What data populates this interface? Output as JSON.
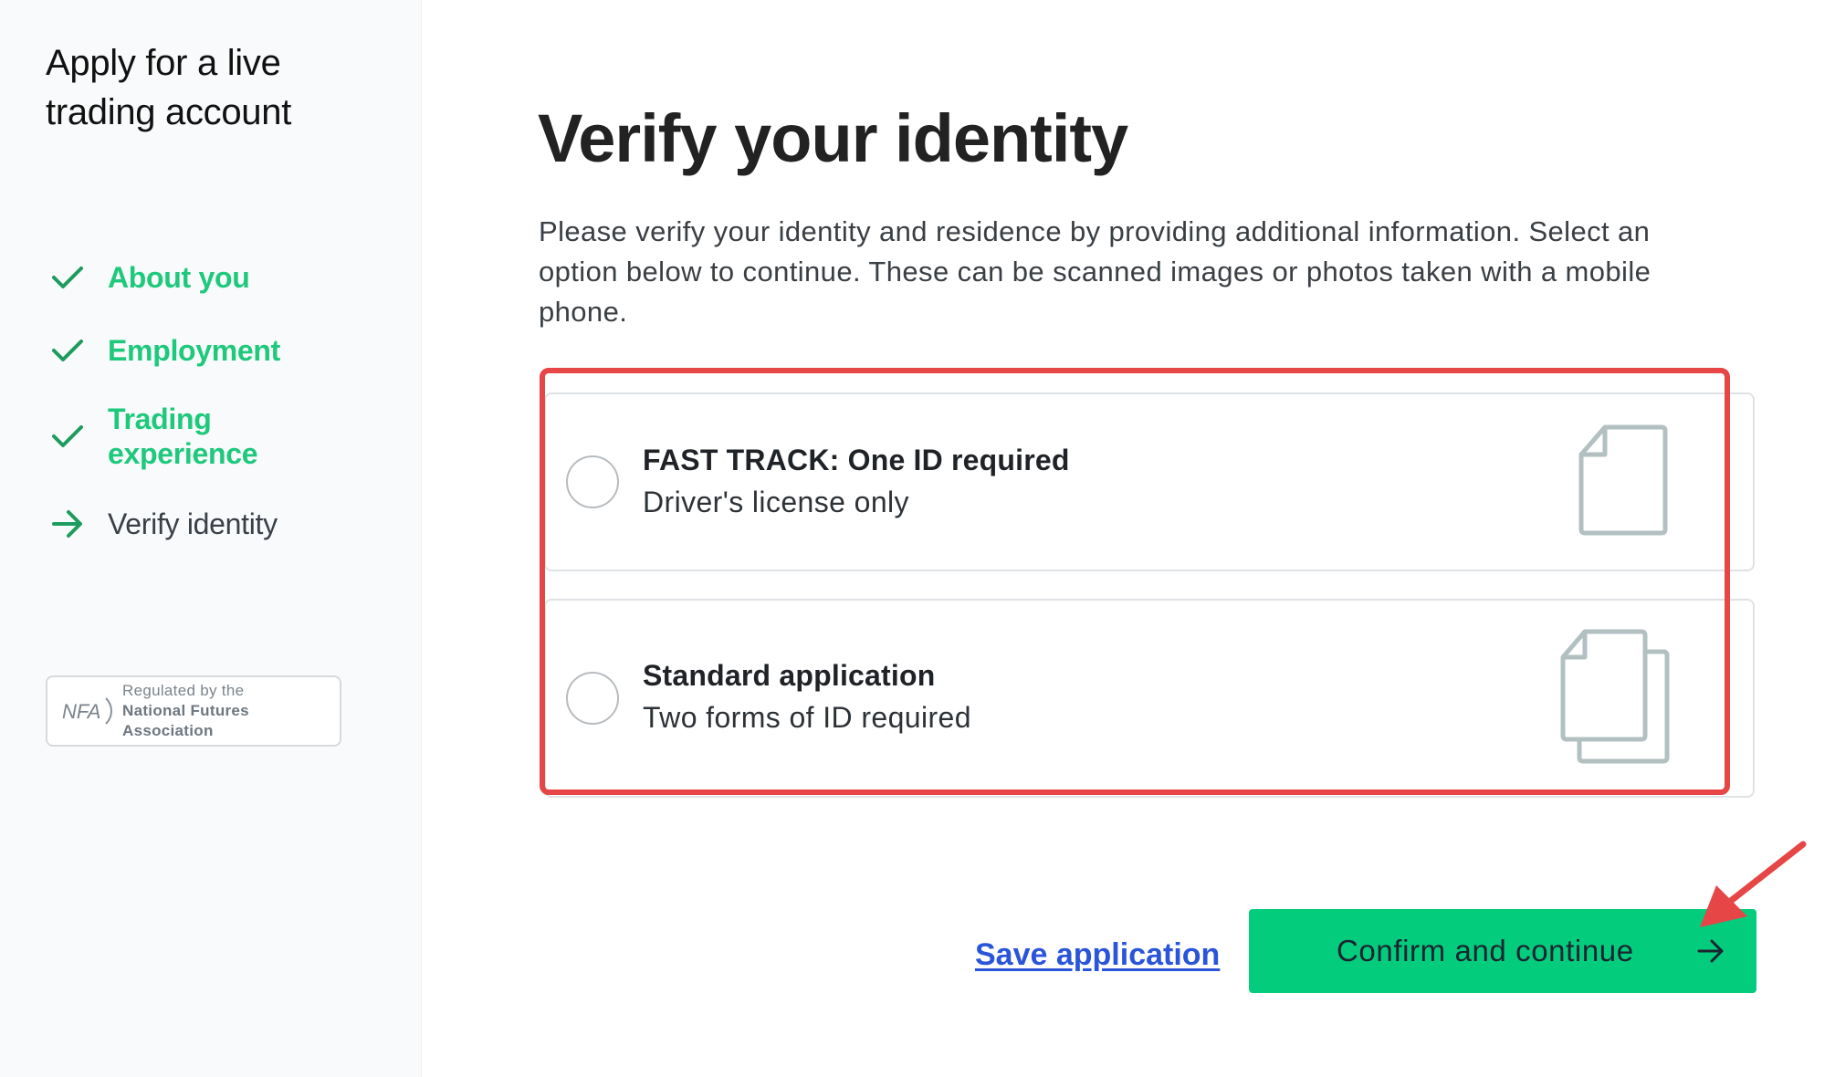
{
  "sidebar": {
    "title": "Apply for a live trading account",
    "steps": [
      {
        "label": "About you",
        "status": "complete",
        "icon": "check-icon"
      },
      {
        "label": "Employment",
        "status": "complete",
        "icon": "check-icon"
      },
      {
        "label": "Trading experience",
        "status": "complete",
        "icon": "check-icon"
      },
      {
        "label": "Verify identity",
        "status": "current",
        "icon": "arrow-right-icon"
      }
    ],
    "nfa_badge": {
      "logo_text": "NFA",
      "line1": "Regulated by the",
      "line2": "National Futures",
      "line3": "Association"
    }
  },
  "main": {
    "title": "Verify your identity",
    "description": "Please verify your identity and residence by providing additional information. Select an option below to continue. These can be scanned images or photos taken with a mobile phone.",
    "options": [
      {
        "title": "FAST TRACK: One ID required",
        "subtitle": "Driver's license only",
        "selected": false,
        "icon": "single-document-icon"
      },
      {
        "title": "Standard application",
        "subtitle": "Two forms of ID required",
        "selected": false,
        "icon": "two-documents-icon"
      }
    ],
    "save_label": "Save application",
    "confirm_label": "Confirm and continue"
  },
  "colors": {
    "accent_green": "#04cc7d",
    "step_green": "#1ec97c",
    "link_blue": "#2a55d9",
    "annotation_red": "#e64646"
  }
}
